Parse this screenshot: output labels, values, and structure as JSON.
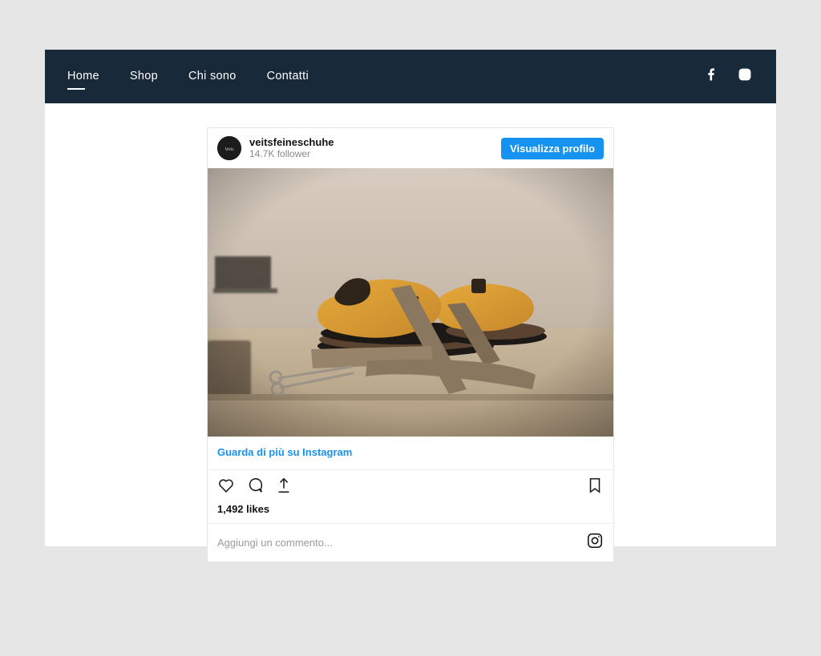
{
  "nav": {
    "items": [
      "Home",
      "Shop",
      "Chi sono",
      "Contatti"
    ],
    "activeIndex": 0
  },
  "instagram": {
    "username": "veitsfeineschuhe",
    "followers_text": "14.7K follower",
    "view_profile_label": "Visualizza profilo",
    "more_link_label": "Guarda di più su Instagram",
    "likes_text": "1,492 likes",
    "comment_placeholder": "Aggiungi un commento..."
  }
}
